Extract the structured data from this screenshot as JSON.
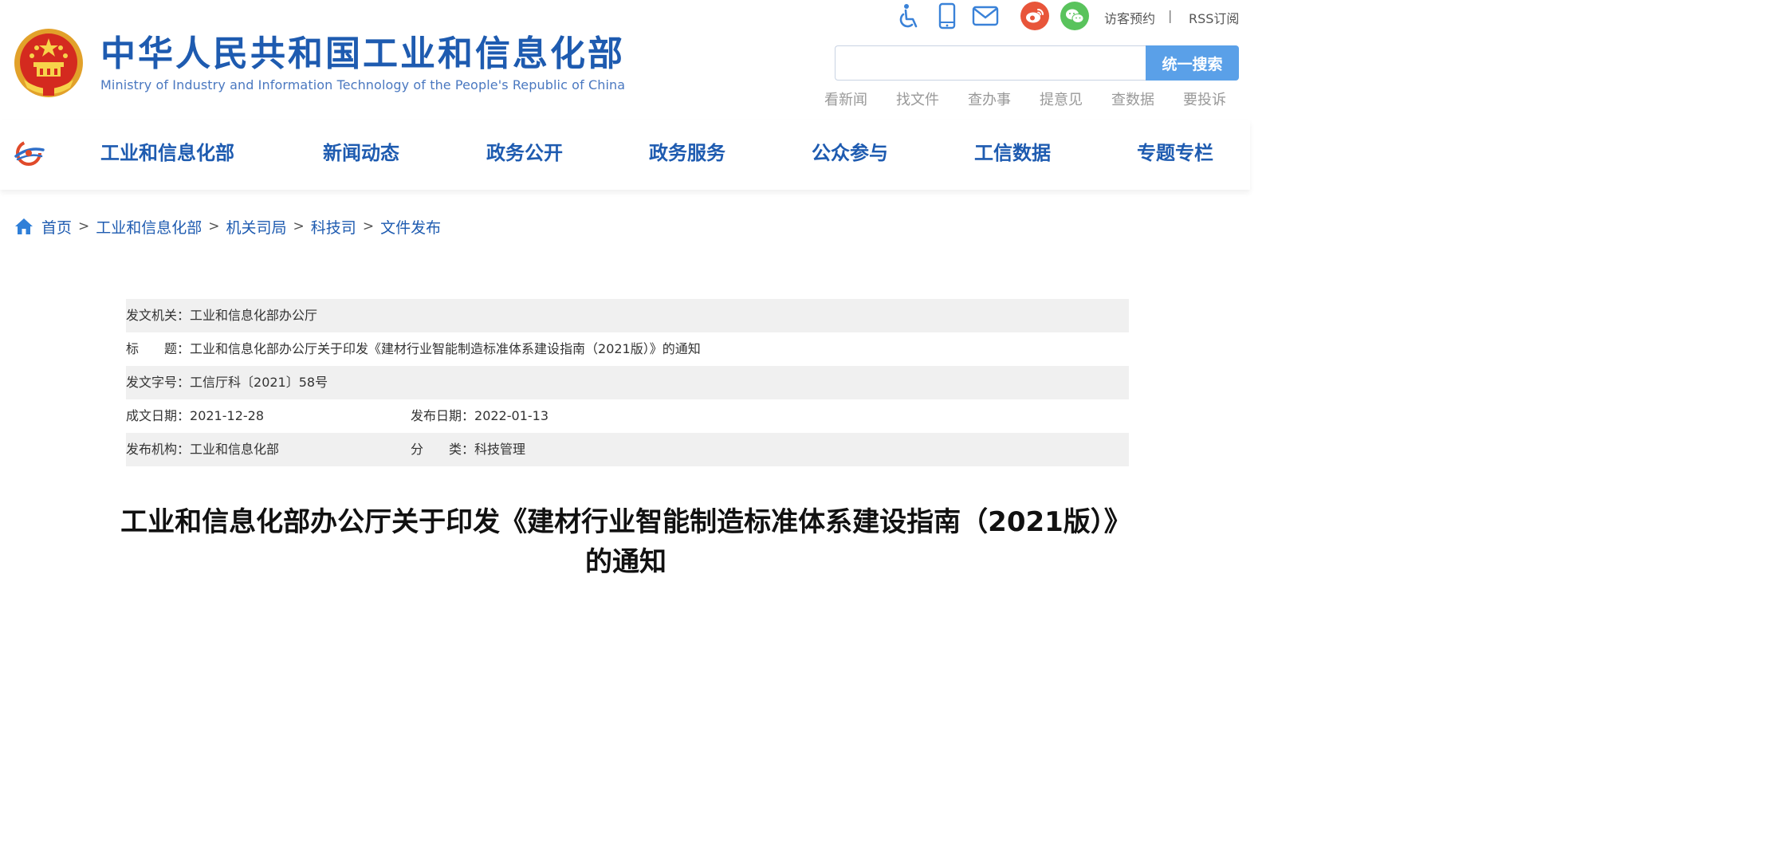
{
  "header": {
    "title_cn": "中华人民共和国工业和信息化部",
    "title_en": "Ministry of Industry and Information Technology of the People's Republic of China",
    "emblem_icon": "national-emblem-icon"
  },
  "tools": {
    "icons": [
      "accessibility-icon",
      "mobile-icon",
      "mail-icon",
      "weibo-icon",
      "wechat-icon"
    ],
    "visitor_label": "访客预约",
    "separator": "|",
    "rss_label": "RSS订阅"
  },
  "search": {
    "placeholder": "",
    "value": "",
    "button_label": "统一搜索",
    "button_color": "#5aa0e8"
  },
  "quick_links": [
    "看新闻",
    "找文件",
    "查办事",
    "提意见",
    "查数据",
    "要投诉"
  ],
  "nav": {
    "logo_icon": "miit-logo-icon",
    "items": [
      "工业和信息化部",
      "新闻动态",
      "政务公开",
      "政务服务",
      "公众参与",
      "工信数据",
      "专题专栏"
    ],
    "color": "#1e5bb0"
  },
  "breadcrumb": {
    "home_icon": "home-icon",
    "items": [
      "首页",
      "工业和信息化部",
      "机关司局",
      "科技司",
      "文件发布"
    ],
    "separator": ">"
  },
  "meta": {
    "issuer_label": "发文机关：",
    "issuer": "工业和信息化部办公厅",
    "title_label": "标　　题：",
    "title": "工业和信息化部办公厅关于印发《建材行业智能制造标准体系建设指南（2021版）》的通知",
    "doc_no_label": "发文字号：",
    "doc_no": "工信厅科〔2021〕58号",
    "written_date_label": "成文日期：",
    "written_date": "2021-12-28",
    "publish_date_label": "发布日期：",
    "publish_date": "2022-01-13",
    "publisher_label": "发布机构：",
    "publisher": "工业和信息化部",
    "category_label": "分　　类：",
    "category": "科技管理"
  },
  "article": {
    "title_line1": "工业和信息化部办公厅关于印发《建材行业智能制造标准体系建设指南（2021版）》",
    "title_line2": "的通知"
  }
}
